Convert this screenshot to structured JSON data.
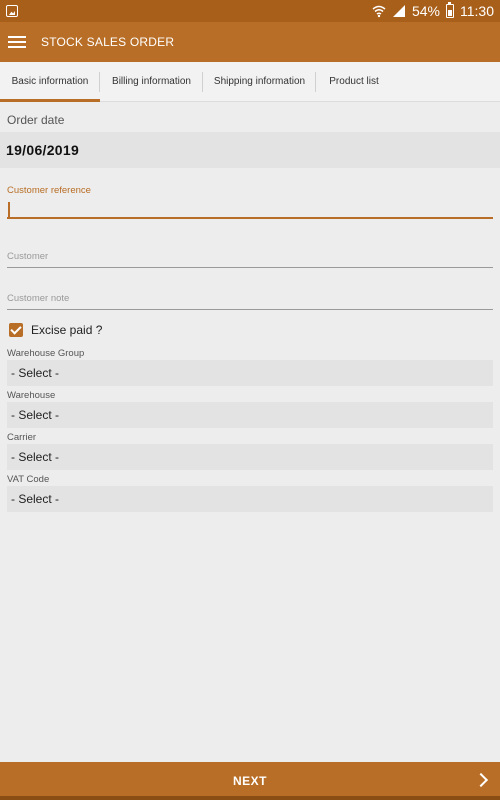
{
  "status_bar": {
    "battery": "54%",
    "time": "11:30"
  },
  "app_bar": {
    "title": "STOCK SALES ORDER"
  },
  "tabs": [
    {
      "label": "Basic information",
      "active": true
    },
    {
      "label": "Billing information",
      "active": false
    },
    {
      "label": "Shipping information",
      "active": false
    },
    {
      "label": "Product list",
      "active": false
    }
  ],
  "form": {
    "order_date_label": "Order date",
    "order_date_value": "19/06/2019",
    "customer_reference_label": "Customer reference",
    "customer_reference_value": "",
    "customer_label": "Customer",
    "customer_note_label": "Customer note",
    "excise_paid_label": "Excise paid ?",
    "excise_paid_checked": true,
    "warehouse_group_label": "Warehouse Group",
    "warehouse_group_value": "-  Select  -",
    "warehouse_label": "Warehouse",
    "warehouse_value": "-  Select  -",
    "carrier_label": "Carrier",
    "carrier_value": "-  Select  -",
    "vat_code_label": "VAT Code",
    "vat_code_value": "-  Select  -"
  },
  "bottom_bar": {
    "next_label": "NEXT"
  },
  "colors": {
    "accent": "#b86e26",
    "status_bar": "#a85f1a"
  }
}
